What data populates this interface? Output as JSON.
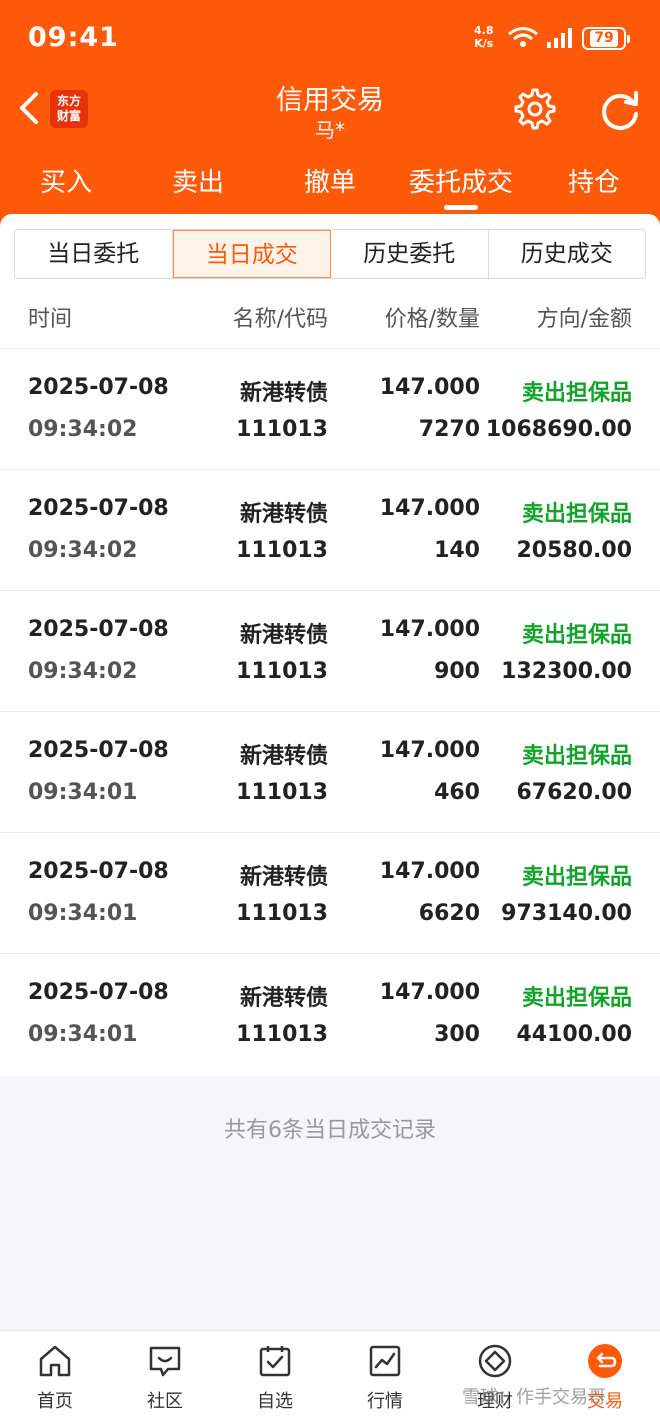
{
  "status_bar": {
    "time": "09:41",
    "net_speed_value": "4.8",
    "net_speed_unit": "K/s",
    "battery": "79"
  },
  "header": {
    "logo_line1": "东方",
    "logo_line2": "财富",
    "title": "信用交易",
    "subtitle": "马*"
  },
  "tabs": [
    "买入",
    "卖出",
    "撤单",
    "委托成交",
    "持仓"
  ],
  "active_tab": "委托成交",
  "segments": [
    "当日委托",
    "当日成交",
    "历史委托",
    "历史成交"
  ],
  "active_segment": "当日成交",
  "table": {
    "headers": [
      "时间",
      "名称/代码",
      "价格/数量",
      "方向/金额"
    ],
    "rows": [
      {
        "date": "2025-07-08",
        "time": "09:34:02",
        "name": "新港转债",
        "code": "111013",
        "price": "147.000",
        "quantity": "7270",
        "direction": "卖出担保品",
        "amount": "1068690.00"
      },
      {
        "date": "2025-07-08",
        "time": "09:34:02",
        "name": "新港转债",
        "code": "111013",
        "price": "147.000",
        "quantity": "140",
        "direction": "卖出担保品",
        "amount": "20580.00"
      },
      {
        "date": "2025-07-08",
        "time": "09:34:02",
        "name": "新港转债",
        "code": "111013",
        "price": "147.000",
        "quantity": "900",
        "direction": "卖出担保品",
        "amount": "132300.00"
      },
      {
        "date": "2025-07-08",
        "time": "09:34:01",
        "name": "新港转债",
        "code": "111013",
        "price": "147.000",
        "quantity": "460",
        "direction": "卖出担保品",
        "amount": "67620.00"
      },
      {
        "date": "2025-07-08",
        "time": "09:34:01",
        "name": "新港转债",
        "code": "111013",
        "price": "147.000",
        "quantity": "6620",
        "direction": "卖出担保品",
        "amount": "973140.00"
      },
      {
        "date": "2025-07-08",
        "time": "09:34:01",
        "name": "新港转债",
        "code": "111013",
        "price": "147.000",
        "quantity": "300",
        "direction": "卖出担保品",
        "amount": "44100.00"
      }
    ]
  },
  "footer_text": "共有6条当日成交记录",
  "bottom_nav": [
    {
      "label": "首页",
      "icon": "home-icon"
    },
    {
      "label": "社区",
      "icon": "community-icon"
    },
    {
      "label": "自选",
      "icon": "watchlist-icon"
    },
    {
      "label": "行情",
      "icon": "market-icon"
    },
    {
      "label": "理财",
      "icon": "wealth-icon"
    },
    {
      "label": "交易",
      "icon": "trade-icon"
    }
  ],
  "watermark": "雪球：作手交易哥",
  "colors": {
    "brand": "#ff5a0a",
    "sell_green": "#13a32b"
  }
}
